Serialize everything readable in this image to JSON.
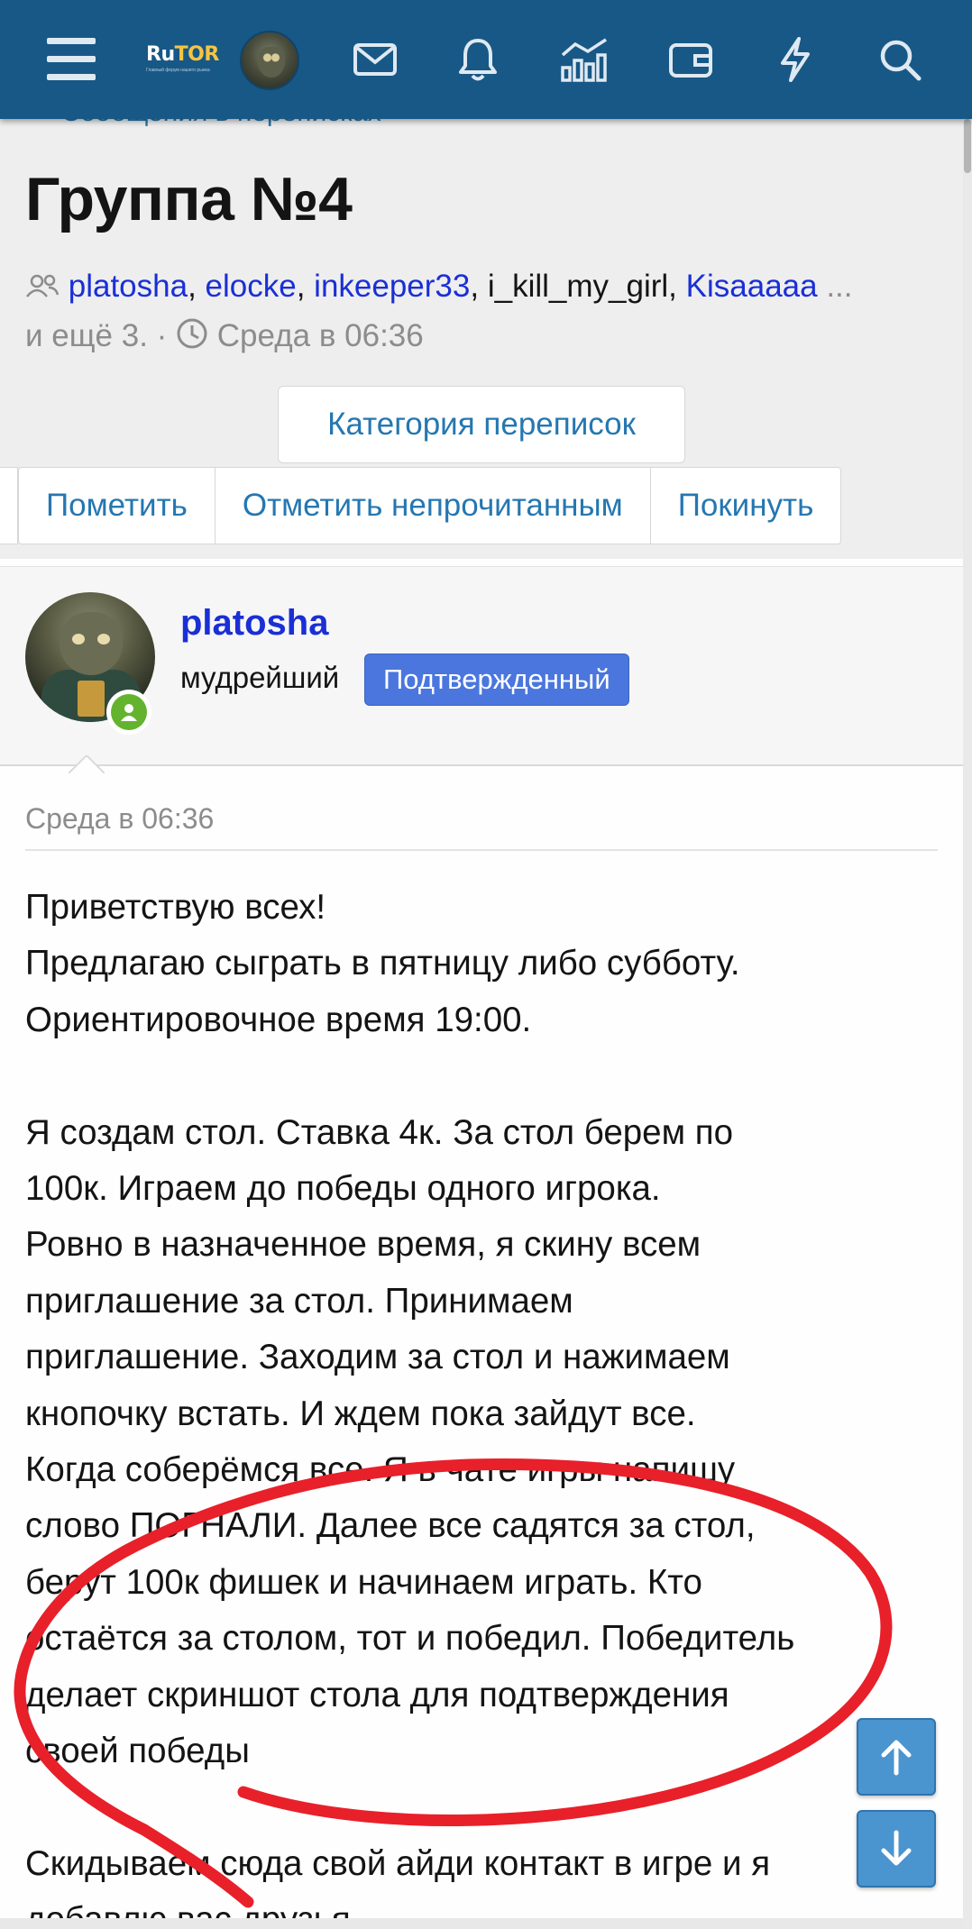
{
  "topbar": {
    "logo": {
      "brand_ru": "Ru",
      "brand_tor": "TOR",
      "tagline": "Главный форум нашего рынка"
    },
    "icons": [
      "menu-icon",
      "avatar",
      "mail-icon",
      "bell-icon",
      "stats-icon",
      "wallet-icon",
      "lightning-icon",
      "search-icon"
    ],
    "accent": "#185886"
  },
  "breadcrumb": {
    "chevron": "<",
    "label": "Сообщения в переписках"
  },
  "page_title": "Группа №4",
  "meta": {
    "participants": [
      "platosha",
      "elocke",
      "inkeeper33",
      "i_kill_my_girl",
      "Kisaaaaa"
    ],
    "sep": ",",
    "ellipsis": " ...",
    "more": "и ещё 3.",
    "dot": " · ",
    "date": "Среда в 06:36"
  },
  "category_button": "Категория переписок",
  "actions": [
    "Пометить",
    "Отметить непрочитанным",
    "Покинуть"
  ],
  "author": {
    "name": "platosha",
    "title": "мудрейший",
    "badge": "Подтвержденный",
    "badge_color": "#4a76de",
    "online_color": "#63b32f"
  },
  "post": {
    "date": "Среда в 06:36",
    "lines": [
      "Приветствую всех!",
      "Предлагаю сыграть в пятницу либо субботу.",
      "Ориентировочное время 19:00.",
      "",
      "Я создам стол. Ставка 4к. За стол берем по",
      "100к. Играем до победы одного игрока.",
      "Ровно в назначенное время, я скину всем",
      "приглашение за стол. Принимаем",
      "приглашение. Заходим за стол и нажимаем",
      "кнопочку встать. И ждем пока зайдут все.",
      "Когда соберёмся все. Я в чате игры напишу",
      "слово ПОГНАЛИ. Далее все садятся за стол,",
      "берут 100к фишек и начинаем играть. Кто",
      "остаётся за столом, тот и победил. Победитель",
      "делает скриншот стола для подтверждения",
      "своей победы",
      "",
      "Скидываем сюда свой айди контакт в игре и я",
      "добавлю вас друзья"
    ]
  },
  "scroll_buttons": {
    "up": "arrow-up-icon",
    "down": "arrow-down-icon"
  },
  "annotation_color": "#e8202a"
}
